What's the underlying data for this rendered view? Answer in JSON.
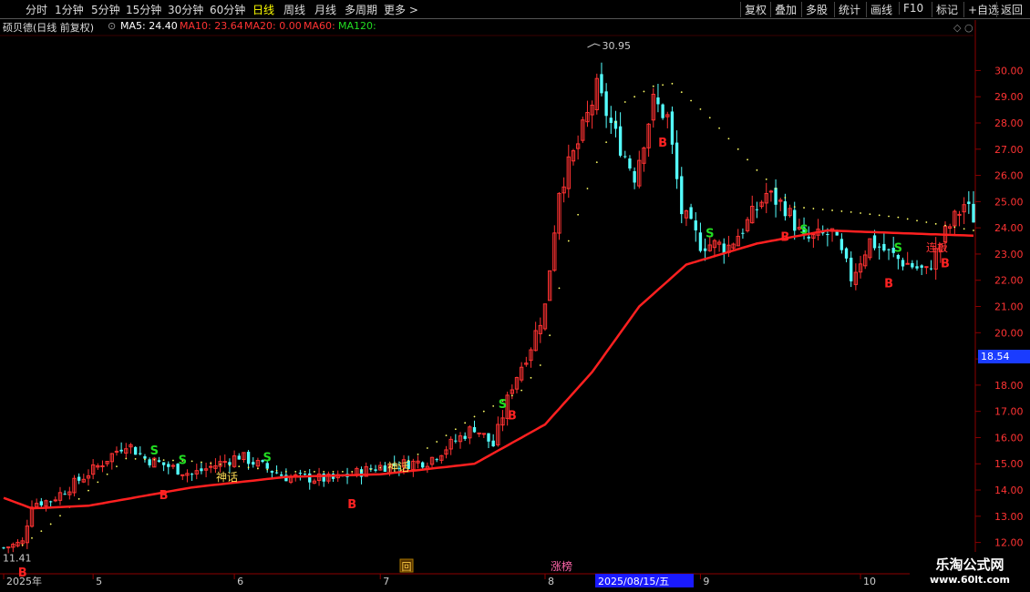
{
  "toolbar": {
    "periods": [
      "分时",
      "1分钟",
      "5分钟",
      "15分钟",
      "30分钟",
      "60分钟",
      "日线",
      "周线",
      "月线",
      "多周期",
      "更多 >"
    ],
    "active_period": "日线",
    "right_buttons": [
      "复权",
      "叠加",
      "多股",
      "统计",
      "画线",
      "F10",
      "标记",
      "+自选",
      "返回"
    ]
  },
  "info": {
    "title": "硕贝德(日线 前复权)",
    "ma5": "MA5: 24.40",
    "ma10": "MA10: 23.64",
    "ma20": "MA20: 0.00",
    "ma60": "MA60:",
    "ma120": "MA120:"
  },
  "colors": {
    "up": "#ff3232",
    "down": "#54ffff",
    "ma_line": "#ff2020",
    "dots": "#ffff66",
    "sell_signal": "#22dd22",
    "buy_signal": "#ff2222"
  },
  "price_axis": {
    "min": 11.5,
    "max": 31.3,
    "ticks": [
      "12.00",
      "13.00",
      "14.00",
      "15.00",
      "16.00",
      "17.00",
      "18.00",
      "19.00",
      "20.00",
      "21.00",
      "22.00",
      "23.00",
      "24.00",
      "25.00",
      "26.00",
      "27.00",
      "28.00",
      "29.00",
      "30.00"
    ],
    "current_price": "18.54"
  },
  "time_axis": {
    "labels": [
      {
        "text": "2025年",
        "day": 0
      },
      {
        "text": "5",
        "day": 19
      },
      {
        "text": "6",
        "day": 49
      },
      {
        "text": "7",
        "day": 80
      },
      {
        "text": "8",
        "day": 115
      },
      {
        "text": "9",
        "day": 148
      },
      {
        "text": "10",
        "day": 182
      }
    ],
    "cursor_label": "2025/08/15/五"
  },
  "annotations": {
    "high_label": "30.95",
    "low_label": "11.41",
    "hui": "回",
    "zhangbang": "涨榜",
    "shenhua": "神话",
    "lianban": "连板",
    "buy": "B",
    "sell": "S"
  },
  "brand": {
    "name": "乐淘公式网",
    "url": "www.60lt.com"
  },
  "chart_data": {
    "type": "candlestick",
    "interval": "daily",
    "approximate": true,
    "keyframes": [
      [
        0,
        11.8
      ],
      [
        4,
        12.0
      ],
      [
        6,
        13.5
      ],
      [
        10,
        13.6
      ],
      [
        20,
        14.9
      ],
      [
        26,
        15.8
      ],
      [
        30,
        15.2
      ],
      [
        40,
        14.6
      ],
      [
        50,
        15.3
      ],
      [
        60,
        14.5
      ],
      [
        70,
        14.4
      ],
      [
        80,
        14.9
      ],
      [
        90,
        15.1
      ],
      [
        100,
        16.4
      ],
      [
        104,
        15.7
      ],
      [
        108,
        18.0
      ],
      [
        112,
        19.5
      ],
      [
        115,
        21.0
      ],
      [
        118,
        25.5
      ],
      [
        122,
        27.2
      ],
      [
        126,
        29.3
      ],
      [
        130,
        27.5
      ],
      [
        134,
        26.0
      ],
      [
        138,
        28.8
      ],
      [
        141,
        28.2
      ],
      [
        144,
        24.6
      ],
      [
        148,
        23.4
      ],
      [
        154,
        23.3
      ],
      [
        158,
        24.2
      ],
      [
        162,
        25.3
      ],
      [
        166,
        24.8
      ],
      [
        170,
        23.5
      ],
      [
        176,
        23.8
      ],
      [
        180,
        22.1
      ],
      [
        184,
        23.5
      ],
      [
        190,
        22.8
      ],
      [
        196,
        22.3
      ],
      [
        200,
        23.8
      ],
      [
        204,
        24.9
      ],
      [
        206,
        24.4
      ]
    ],
    "ma_curve": [
      [
        0,
        13.7
      ],
      [
        6,
        13.3
      ],
      [
        18,
        13.4
      ],
      [
        40,
        14.1
      ],
      [
        60,
        14.5
      ],
      [
        80,
        14.6
      ],
      [
        100,
        15.0
      ],
      [
        115,
        16.5
      ],
      [
        125,
        18.5
      ],
      [
        135,
        21.0
      ],
      [
        145,
        22.6
      ],
      [
        160,
        23.4
      ],
      [
        175,
        23.9
      ],
      [
        190,
        23.8
      ],
      [
        206,
        23.7
      ]
    ],
    "dots_curve": [
      [
        4,
        11.9
      ],
      [
        10,
        12.7
      ],
      [
        20,
        14.3
      ],
      [
        26,
        15.2
      ],
      [
        40,
        15.1
      ],
      [
        60,
        14.7
      ],
      [
        75,
        14.7
      ],
      [
        85,
        15.0
      ],
      [
        100,
        16.8
      ],
      [
        110,
        17.8
      ],
      [
        115,
        19.0
      ],
      [
        120,
        23.5
      ],
      [
        126,
        26.5
      ],
      [
        132,
        28.8
      ],
      [
        138,
        29.4
      ],
      [
        142,
        29.5
      ],
      [
        150,
        28.2
      ],
      [
        160,
        26.2
      ],
      [
        168,
        24.8
      ],
      [
        180,
        24.6
      ],
      [
        190,
        24.4
      ],
      [
        206,
        23.9
      ]
    ],
    "buy_signals": [
      4,
      34,
      74,
      108,
      140,
      166,
      188,
      200
    ],
    "sell_signals": [
      32,
      38,
      56,
      106,
      150,
      170,
      190
    ]
  }
}
